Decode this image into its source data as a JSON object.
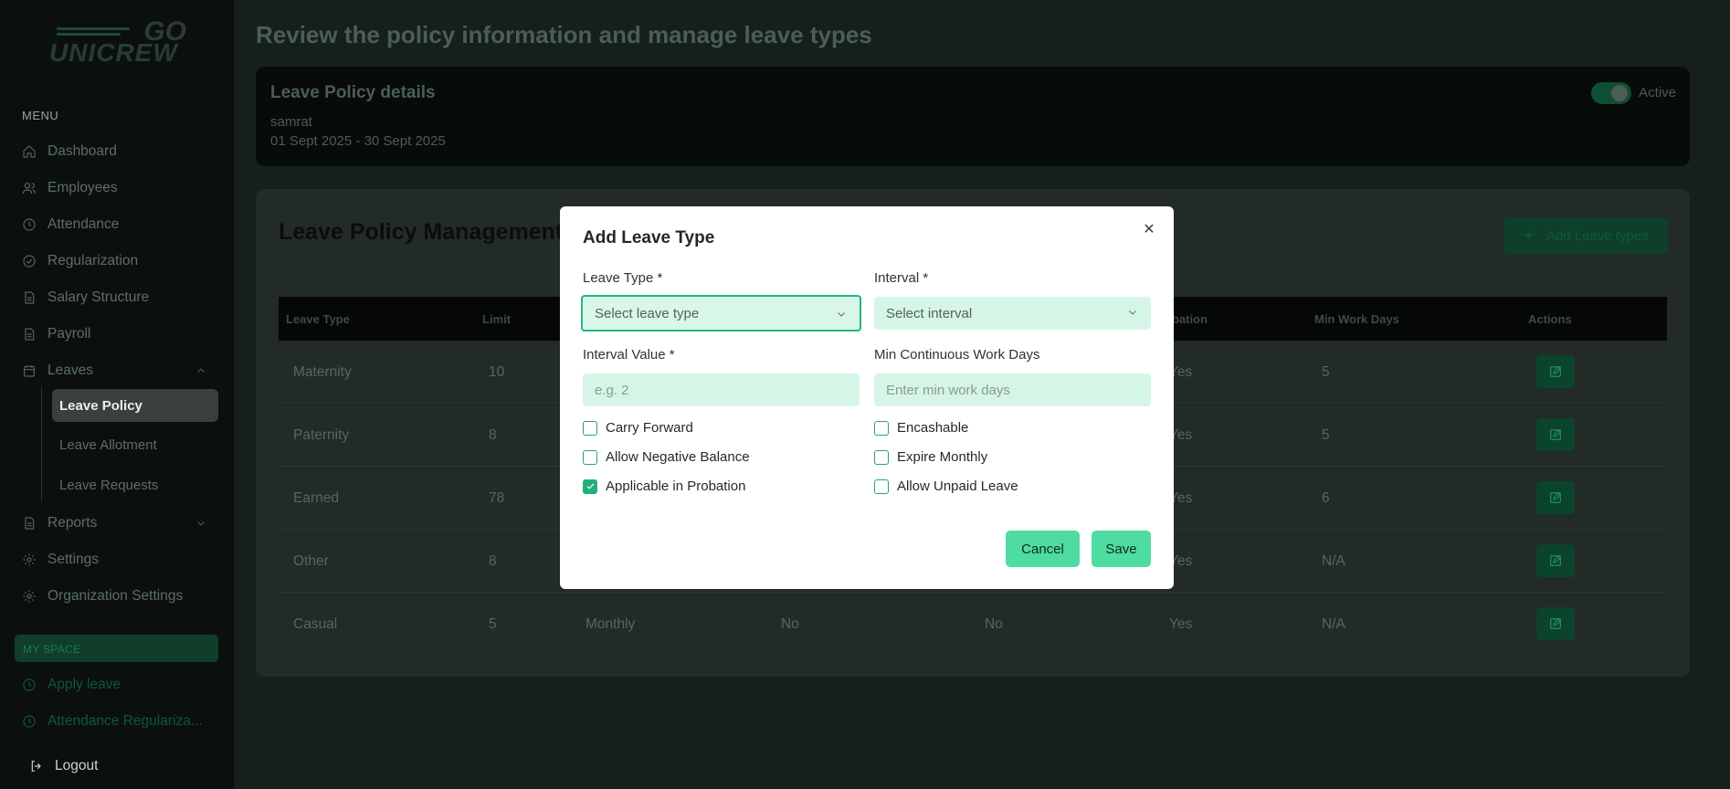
{
  "brand": {
    "logo_top": "GO",
    "logo_main": "UNICREW"
  },
  "sidebar": {
    "menu_label": "MENU",
    "items": [
      {
        "label": "Dashboard",
        "icon": "home-icon"
      },
      {
        "label": "Employees",
        "icon": "users-icon"
      },
      {
        "label": "Attendance",
        "icon": "clock-icon"
      },
      {
        "label": "Regularization",
        "icon": "check-circle-icon"
      },
      {
        "label": "Salary Structure",
        "icon": "document-icon"
      },
      {
        "label": "Payroll",
        "icon": "document-icon"
      },
      {
        "label": "Leaves",
        "icon": "calendar-icon"
      }
    ],
    "leave_sub": [
      "Leave Policy",
      "Leave Allotment",
      "Leave Requests"
    ],
    "items_after": [
      {
        "label": "Reports",
        "icon": "document-icon"
      },
      {
        "label": "Settings",
        "icon": "gear-icon"
      },
      {
        "label": "Organization Settings",
        "icon": "gear-icon"
      }
    ],
    "myspace_label": "MY SPACE",
    "myspace_items": [
      "Apply leave",
      "Attendance Regulariza..."
    ],
    "logout_label": "Logout"
  },
  "page": {
    "title": "Review the policy information and manage leave types",
    "policy": {
      "title": "Leave Policy details",
      "name": "samrat",
      "dates": "01 Sept 2025 - 30 Sept 2025",
      "status_label": "Active"
    },
    "management": {
      "title": "Leave Policy Management",
      "add_button": "Add Leave types",
      "columns": [
        "Leave Type",
        "Limit",
        "",
        "",
        "",
        "obation",
        "Min Work Days",
        "Actions"
      ],
      "rows": [
        {
          "type": "Maternity",
          "limit": "10",
          "interval": "",
          "c4": "",
          "c5": "",
          "probation": "Yes",
          "min_days": "5"
        },
        {
          "type": "Paternity",
          "limit": "8",
          "interval": "",
          "c4": "",
          "c5": "",
          "probation": "Yes",
          "min_days": "5"
        },
        {
          "type": "Earned",
          "limit": "78",
          "interval": "",
          "c4": "",
          "c5": "",
          "probation": "Yes",
          "min_days": "6"
        },
        {
          "type": "Other",
          "limit": "8",
          "interval": "",
          "c4": "",
          "c5": "",
          "probation": "Yes",
          "min_days": "N/A"
        },
        {
          "type": "Casual",
          "limit": "5",
          "interval": "Monthly",
          "c4": "No",
          "c5": "No",
          "probation": "Yes",
          "min_days": "N/A"
        }
      ]
    }
  },
  "modal": {
    "title": "Add Leave Type",
    "leave_type_label": "Leave Type *",
    "leave_type_value": "Select leave type",
    "interval_label": "Interval *",
    "interval_value": "Select interval",
    "interval_value_label": "Interval Value *",
    "interval_value_placeholder": "e.g. 2",
    "min_days_label": "Min Continuous Work Days",
    "min_days_placeholder": "Enter min work days",
    "checkboxes": [
      {
        "label": "Carry Forward",
        "checked": false
      },
      {
        "label": "Encashable",
        "checked": false
      },
      {
        "label": "Allow Negative Balance",
        "checked": false
      },
      {
        "label": "Expire Monthly",
        "checked": false
      },
      {
        "label": "Applicable in Probation",
        "checked": true
      },
      {
        "label": "Allow Unpaid Leave",
        "checked": false
      }
    ],
    "cancel_label": "Cancel",
    "save_label": "Save"
  },
  "colors": {
    "accent": "#4fdca3",
    "field_bg": "#d5f6e6",
    "sidebar_bg": "#0b100e"
  }
}
